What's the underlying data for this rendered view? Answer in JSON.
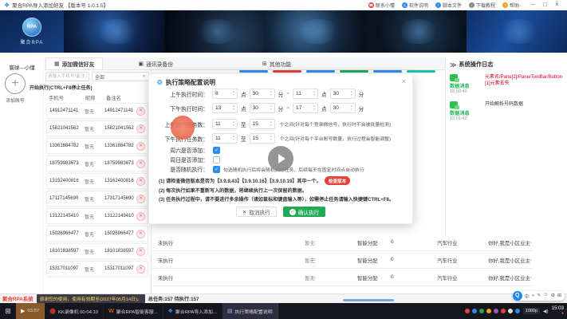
{
  "window": {
    "title": "聚合RPA导入添加好友 【版本号 1.0.1.5】",
    "controls": {
      "min": "–",
      "max": "□",
      "close": "×"
    },
    "toolbar": [
      {
        "glyph": "☎",
        "label": "联系小懂",
        "color": "#e7413a"
      },
      {
        "glyph": "≡",
        "label": "软件说明",
        "color": "#2d8cf0"
      },
      {
        "glyph": "i",
        "label": "脚本文件",
        "color": "#2d8cf0"
      },
      {
        "glyph": "↓",
        "label": "下载教程",
        "color": "#8a8a8a"
      },
      {
        "glyph": "?",
        "label": "帮助",
        "color": "#f0a020"
      }
    ]
  },
  "brand": {
    "logo_text": "RPA",
    "logo_caption": "聚合RPA",
    "slogan": "寰球—小懂"
  },
  "tabs": [
    {
      "icon": "▦",
      "label": "添加微信好友",
      "active": true
    },
    {
      "icon": "▣",
      "label": "通讯录备份",
      "active": false
    },
    {
      "icon": "⊞",
      "label": "其他功能",
      "active": false
    }
  ],
  "carousel_pills": [
    {
      "color": "#2d8cf0"
    },
    {
      "color": "#e7413a"
    },
    {
      "color": "#2d8cf0"
    },
    {
      "color": "#21a956"
    },
    {
      "color": "#2d8cf0"
    },
    {
      "color": "#17c3b2"
    }
  ],
  "left_panel": {
    "add_button": "+",
    "add_label": "添加账号",
    "stop_hint": "开始执行(CTRL+F8停止任务)",
    "search_placeholder": "请输入手机号/备注 搜索",
    "filter_value": "全部",
    "headers": {
      "h1": "手机号",
      "h2": "昵称",
      "h3": "备注名"
    },
    "rows": [
      {
        "phone": "14912471141",
        "name": "暂无",
        "remark": "14912471141"
      },
      {
        "phone": "15821041562",
        "name": "暂无",
        "remark": "15821041562"
      },
      {
        "phone": "13361884782",
        "name": "暂无",
        "remark": "13361884782"
      },
      {
        "phone": "18759983673",
        "name": "暂无",
        "remark": "18759983673"
      },
      {
        "phone": "13152400816",
        "name": "暂无",
        "remark": "13162400816"
      },
      {
        "phone": "17117145690",
        "name": "暂无",
        "remark": "17317145690"
      },
      {
        "phone": "13122145410",
        "name": "暂无",
        "remark": "13122149410"
      },
      {
        "phone": "15026966477",
        "name": "暂无",
        "remark": "15026966477"
      },
      {
        "phone": "18101838597",
        "name": "暂无",
        "remark": "18101838597"
      },
      {
        "phone": "15317011097",
        "name": "暂无",
        "remark": "15317011097"
      }
    ]
  },
  "main_table": {
    "rows": [
      {
        "c1": "未执行",
        "c2": "暂无",
        "c3": "智能分配",
        "c4": "0",
        "c5": "汽车行业",
        "c6": "你好,我是小区业主什么的"
      },
      {
        "c1": "未执行",
        "c2": "暂无",
        "c3": "智能分配",
        "c4": "0",
        "c5": "汽车行业",
        "c6": "你好,我是小区业主什么的"
      },
      {
        "c1": "未执行",
        "c2": "暂无",
        "c3": "智能分配",
        "c4": "0",
        "c5": "汽车行业",
        "c6": "你好,我是小区业主什么的"
      }
    ]
  },
  "dialog": {
    "title": "执行策略配置说明",
    "close": "×",
    "time_am": {
      "label": "上午执行时间：",
      "h": "8",
      "u1": "点",
      "m": "30",
      "u2": "分",
      "sep": "~",
      "h2": "11",
      "u3": "点",
      "m2": "30",
      "u4": "分"
    },
    "time_pm": {
      "label": "下午执行时间：",
      "h": "13",
      "u1": "点",
      "m": "30",
      "u2": "分",
      "sep": "~",
      "h2": "17",
      "u3": "点",
      "m2": "30",
      "u4": "分"
    },
    "count_am": {
      "label": "上午执行任务数：",
      "from": "11",
      "mid": "至",
      "to": "15",
      "tail": "个之间(针对每个登录微信号，执行时不会被批量检测)"
    },
    "count_pm": {
      "label": "下午执行任务数：",
      "from": "11",
      "mid": "至",
      "to": "15",
      "tail": "个之间(针对每个平台账号数量，执行过程会智能调整)"
    },
    "saturday": {
      "label": "周六是否添加：",
      "mark": "✓"
    },
    "sunday": {
      "label": "周日是否添加：",
      "mark": ""
    },
    "random": {
      "label": "是否随机执行：",
      "mark": "✓",
      "tail": "勾选随机执行后将会随机执行任务，后续每天在固定时间点自动执行"
    },
    "note1": "(1) 请检查微信版本是否为【3.9.9.43】【3.9.10.16】【3.9.10.19】其中一个。",
    "note1_badge": "检查版本",
    "note2": "(2) 每次执行如果不重新写入的数据，将继续执行上一次保留的数据。",
    "note3": "(3) 任务执行过程中，请不要进行多余操作（诸如鼠标和键盘输入等），如需停止任务请输入快捷键CTRL+F8。",
    "cancel": "取消执行",
    "confirm": "确认执行",
    "confirm_check": "✓",
    "cancel_x": "✕"
  },
  "log_panel": {
    "chevron": "≫",
    "title": "系统操作日志",
    "entries": [
      {
        "tag": "数据消息",
        "time": "15:00:40",
        "message": "元素名/Pane[2]/Pane/ToolBar/Button[1]元素丢失",
        "error": true
      },
      {
        "tag": "数据消息",
        "time": "15:01:42",
        "message": "开始解析号码数据",
        "error": false
      }
    ]
  },
  "status_bar": {
    "app": "聚合RPA系统",
    "license": "感谢您的使用，使用有效期至(2027年05月14日)。",
    "stats": "总任务:157  待执行:157"
  },
  "ime": {
    "q": "Q",
    "glyphs": [
      {
        "g": "中"
      },
      {
        "g": "⌁"
      },
      {
        "g": "✎"
      },
      {
        "g": "☺"
      },
      {
        "g": "⚙"
      },
      {
        "g": "⊞"
      }
    ]
  },
  "taskbar": {
    "start": "⊞",
    "items": [
      {
        "icon": "▶",
        "label": "03:57",
        "bg": "#8a5a2b",
        "iconColor": "#ffffff"
      },
      {
        "icon": "⬤",
        "label": "KK录像机 00:04:10",
        "bg": "",
        "iconColor": "#b03030"
      },
      {
        "icon": "W",
        "label": "聚合RPA智能客服...",
        "bg": "",
        "iconColor": "#ff7f27"
      },
      {
        "icon": "❖",
        "label": "聚合RPA导入添加...",
        "bg": "",
        "iconColor": "#3aa0ff"
      },
      {
        "icon": "▤",
        "label": "执行策略配置说明",
        "bg": "#2e2e3e",
        "iconColor": "#7ec8ff"
      }
    ],
    "tray_dots": [
      {
        "color": "#e7413a"
      },
      {
        "color": "#2d8cf0"
      },
      {
        "color": "#21a956"
      },
      {
        "color": "#f0a020"
      },
      {
        "color": "#9b59b6"
      },
      {
        "color": "#e7413a"
      },
      {
        "color": "#dddddd"
      },
      {
        "color": "#2d8cf0"
      }
    ],
    "res_chip": "1080p",
    "speaker": "◀)",
    "time": "15:03",
    "time_note": "●"
  }
}
